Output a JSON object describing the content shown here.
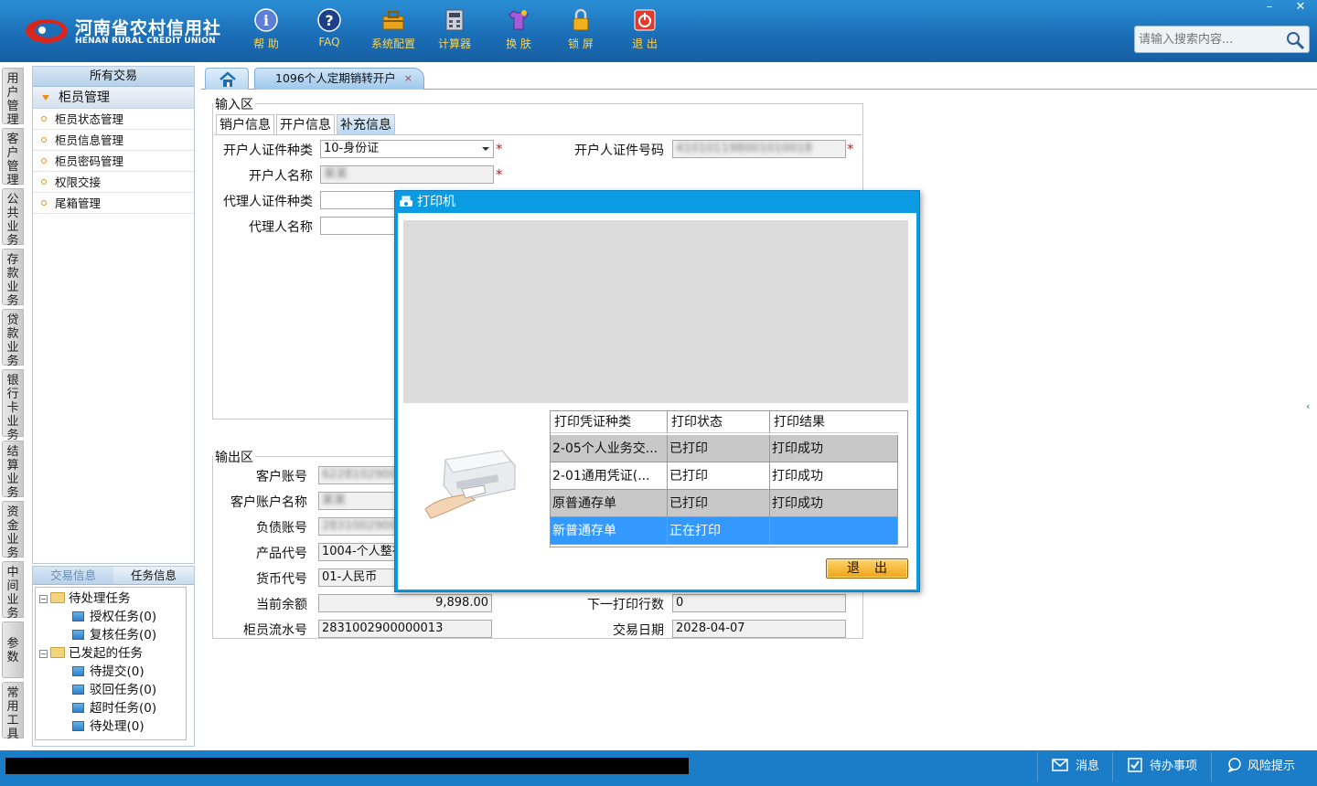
{
  "header": {
    "logo_cn": "河南省农村信用社",
    "logo_en": "HENAN RURAL CREDIT UNION",
    "tools": [
      {
        "label": "帮 助",
        "icon": "info-icon"
      },
      {
        "label": "FAQ",
        "icon": "question-icon"
      },
      {
        "label": "系统配置",
        "icon": "toolbox-icon"
      },
      {
        "label": "计算器",
        "icon": "calculator-icon"
      },
      {
        "label": "换 肤",
        "icon": "tshirt-icon"
      },
      {
        "label": "锁 屏",
        "icon": "lock-icon"
      },
      {
        "label": "退 出",
        "icon": "power-icon"
      }
    ],
    "search_placeholder": "请输入搜索内容...",
    "minimize": "–",
    "close": "✕"
  },
  "side_tabs": [
    "用户管理",
    "客户管理",
    "公共业务",
    "存款业务",
    "贷款业务",
    "银行卡业务",
    "结算业务",
    "资金业务",
    "中间业务",
    "参数",
    "常用工具"
  ],
  "left_panel": {
    "title": "所有交易",
    "group": "柜员管理",
    "items": [
      "柜员状态管理",
      "柜员信息管理",
      "柜员密码管理",
      "权限交接",
      "尾箱管理"
    ]
  },
  "task_panel": {
    "tabs": [
      "交易信息",
      "任务信息"
    ],
    "tree": [
      {
        "label": "待处理任务",
        "level": 0
      },
      {
        "label": "授权任务(0)",
        "level": 1
      },
      {
        "label": "复核任务(0)",
        "level": 1
      },
      {
        "label": "已发起的任务",
        "level": 0
      },
      {
        "label": "待提交(0)",
        "level": 1
      },
      {
        "label": "驳回任务(0)",
        "level": 1
      },
      {
        "label": "超时任务(0)",
        "level": 1
      },
      {
        "label": "待处理(0)",
        "level": 1
      }
    ]
  },
  "tabs": {
    "current": "1096个人定期销转开户",
    "close": "×"
  },
  "input_area": {
    "legend": "输入区",
    "subtabs": [
      "销户信息",
      "开户信息",
      "补充信息"
    ],
    "fields": {
      "id_type_label": "开户人证件种类",
      "id_type_value": "10-身份证",
      "id_no_label": "开户人证件号码",
      "id_no_value": "410101198001010018",
      "name_label": "开户人名称",
      "name_value": "某某",
      "agent_id_type_label": "代理人证件种类",
      "agent_name_label": "代理人名称",
      "required_mark": "*"
    }
  },
  "output_area": {
    "legend": "输出区",
    "cust_acct_label": "客户账号",
    "cust_acct_value": "6228102900123",
    "cust_name_label": "客户账户名称",
    "cust_name_value": "某某",
    "debt_acct_label": "负债账号",
    "debt_acct_value": "283100290012",
    "product_label": "产品代号",
    "product_value": "1004-个人整存",
    "currency_label": "货币代号",
    "currency_value": "01-人民币",
    "balance_label": "当前余额",
    "balance_value": "9,898.00",
    "next_line_label": "下一打印行数",
    "next_line_value": "0",
    "serial_label": "柜员流水号",
    "serial_value": "2831002900000013",
    "date_label": "交易日期",
    "date_value": "2028-04-07"
  },
  "dialog": {
    "title": "打印机",
    "headers": [
      "打印凭证种类",
      "打印状态",
      "打印结果"
    ],
    "rows": [
      [
        "2-05个人业务交...",
        "已打印",
        "打印成功"
      ],
      [
        "2-01通用凭证(...",
        "已打印",
        "打印成功"
      ],
      [
        "原普通存单",
        "已打印",
        "打印成功"
      ],
      [
        "新普通存单",
        "正在打印",
        ""
      ]
    ],
    "exit": "退出"
  },
  "status_bar": {
    "message": "消息",
    "todo": "待办事项",
    "risk": "风险提示"
  },
  "colors": {
    "header_blue": "#1b6fb8",
    "dialog_blue": "#0a9be3",
    "tool_label_yellow": "#ffd54a",
    "selected_row": "#3399ff",
    "required_red": "#d11111"
  }
}
